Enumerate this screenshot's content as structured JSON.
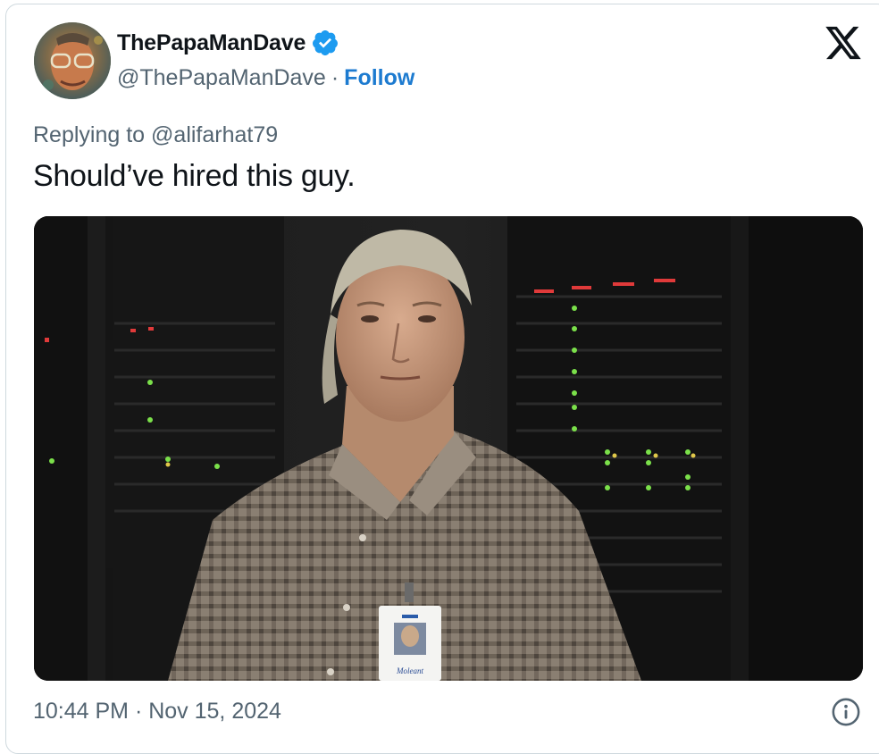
{
  "author": {
    "display_name": "ThePapaManDave",
    "handle": "@ThePapaManDave",
    "separator": "·",
    "follow_label": "Follow",
    "verified": true
  },
  "tweet": {
    "replying_prefix": "Replying to ",
    "replying_handle": "@alifarhat79",
    "text": "Should’ve hired this guy."
  },
  "media": {
    "badge_text": "Moleant"
  },
  "meta": {
    "timestamp": "10:44 PM · Nov 15, 2024"
  },
  "colors": {
    "accent": "#1d7bd0",
    "secondary_text": "#536471",
    "primary_text": "#0f1419",
    "verified_badge": "#1d9bf0",
    "border": "#cfd9de"
  },
  "icons": {
    "brand": "x-logo-icon",
    "verified": "verified-badge-icon",
    "info": "info-icon"
  }
}
